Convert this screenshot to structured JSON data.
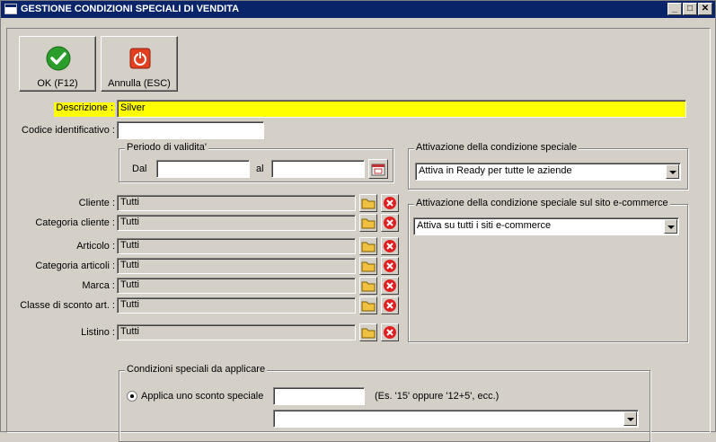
{
  "window": {
    "title": "GESTIONE CONDIZIONI SPECIALI DI VENDITA",
    "min": "_",
    "max": "□",
    "close": "✕"
  },
  "toolbar": {
    "ok_label": "OK (F12)",
    "cancel_label": "Annulla (ESC)"
  },
  "form": {
    "descrizione_label": "Descrizione :",
    "descrizione_value": "Silver",
    "codice_label": "Codice identificativo :",
    "codice_value": "",
    "periodo": {
      "title": "Periodo di validita'",
      "dal_label": "Dal",
      "al_label": "al",
      "dal_value": "",
      "al_value": ""
    },
    "attivazione": {
      "title": "Attivazione della condizione speciale",
      "value": "Attiva in Ready per tutte le aziende"
    },
    "ecommerce": {
      "title": "Attivazione della condizione speciale sul sito e-commerce",
      "value": "Attiva su tutti i siti e-commerce"
    },
    "filters": [
      {
        "label": "Cliente :",
        "value": "Tutti"
      },
      {
        "label": "Categoria cliente :",
        "value": "Tutti"
      },
      {
        "label": "Articolo :",
        "value": "Tutti"
      },
      {
        "label": "Categoria articoli :",
        "value": "Tutti"
      },
      {
        "label": "Marca :",
        "value": "Tutti"
      },
      {
        "label": "Classe di sconto art. :",
        "value": "Tutti"
      },
      {
        "label": "Listino :",
        "value": "Tutti"
      }
    ],
    "condizioni": {
      "title": "Condizioni speciali da applicare",
      "sconto_label": "Applica uno sconto speciale",
      "sconto_value": "",
      "sconto_hint": "(Es. '15' oppure '12+5', ecc.)",
      "combo_value": ""
    }
  },
  "colors": {
    "titlebar": "#0a246a",
    "highlight": "#ffff00",
    "face": "#d4d0c8"
  }
}
